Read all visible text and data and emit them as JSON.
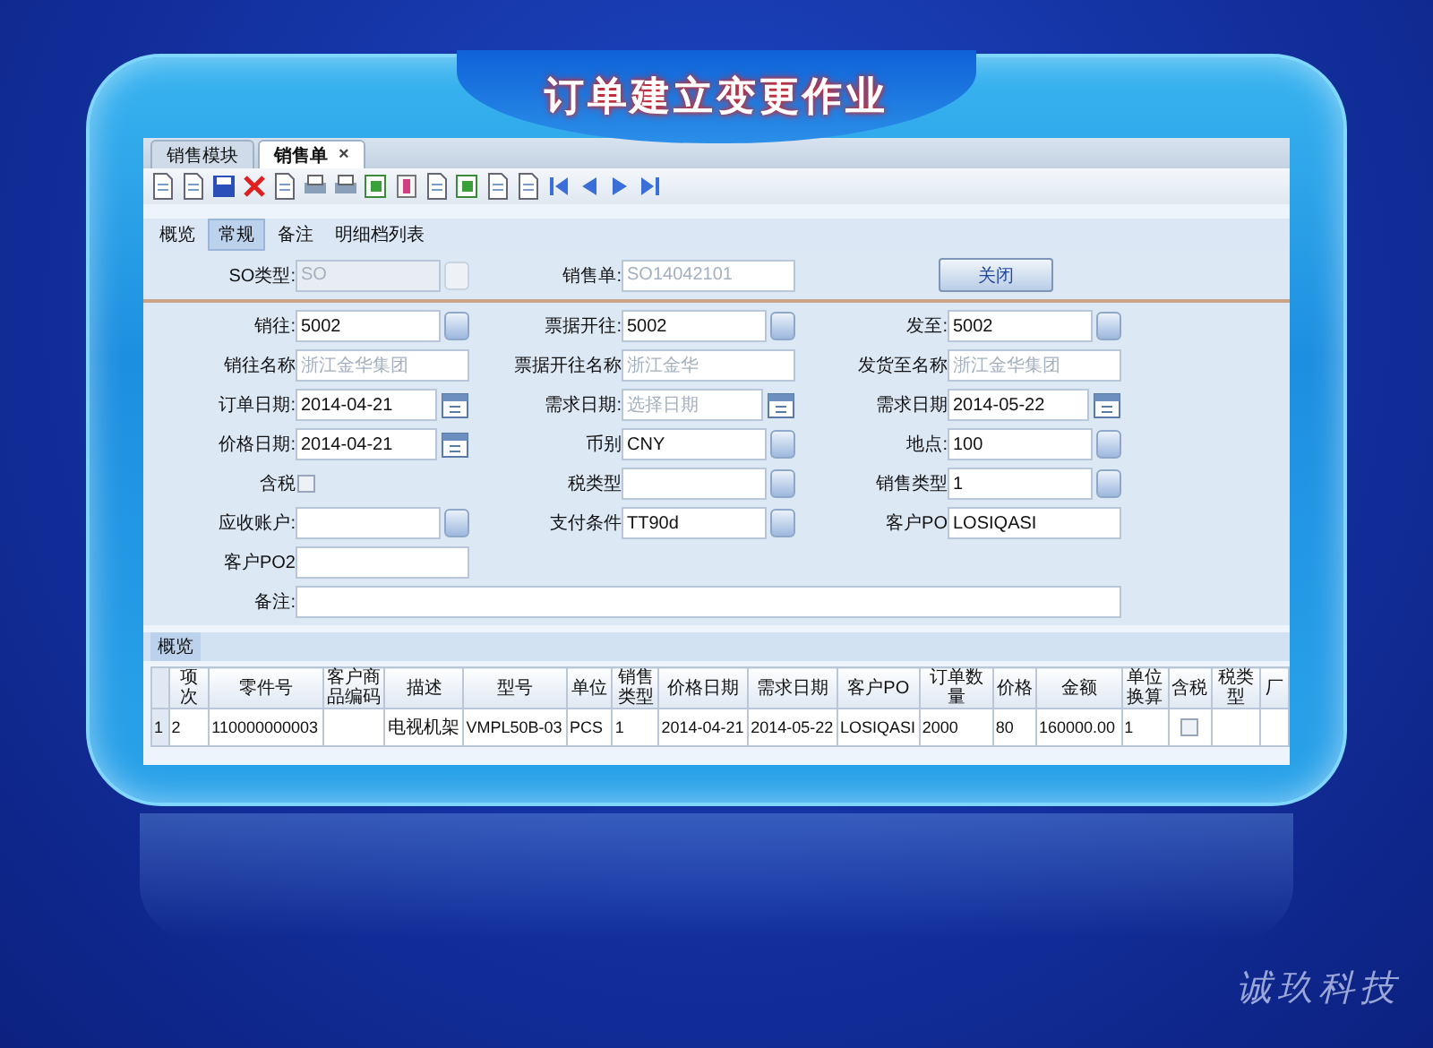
{
  "banner": {
    "title": "订单建立变更作业"
  },
  "tabs": [
    {
      "label": "销售模块",
      "selected": false
    },
    {
      "label": "销售单",
      "selected": true,
      "close": "×"
    }
  ],
  "subtabs": [
    {
      "label": "概览",
      "selected": false
    },
    {
      "label": "常规",
      "selected": true
    },
    {
      "label": "备注",
      "selected": false
    },
    {
      "label": "明细档列表",
      "selected": false
    }
  ],
  "form": {
    "rows": [
      {
        "fields": [
          {
            "kind": "combo",
            "label": "SO类型:",
            "placeholder": "SO",
            "disabled": true
          },
          {
            "kind": "text",
            "label": "销售单:",
            "placeholder": "SO14042101"
          },
          {
            "kind": "button",
            "label": "关闭"
          }
        ]
      },
      {
        "fields": [
          {
            "kind": "combo",
            "label": "销往:",
            "value": "5002"
          },
          {
            "kind": "combo",
            "label": "票据开往:",
            "value": "5002"
          },
          {
            "kind": "combo",
            "label": "发至:",
            "value": "5002"
          }
        ]
      },
      {
        "fields": [
          {
            "kind": "text",
            "label": "销往名称",
            "placeholder": "浙江金华集团"
          },
          {
            "kind": "text",
            "label": "票据开往名称",
            "placeholder": "浙江金华"
          },
          {
            "kind": "text",
            "label": "发货至名称",
            "placeholder": "浙江金华集团"
          }
        ]
      },
      {
        "fields": [
          {
            "kind": "date",
            "label": "订单日期:",
            "value": "2014-04-21"
          },
          {
            "kind": "date",
            "label": "需求日期:",
            "placeholder": "选择日期"
          },
          {
            "kind": "date",
            "label": "需求日期",
            "value": "2014-05-22"
          }
        ]
      },
      {
        "fields": [
          {
            "kind": "date",
            "label": "价格日期:",
            "value": "2014-04-21"
          },
          {
            "kind": "combo",
            "label": "币别",
            "value": "CNY"
          },
          {
            "kind": "combo",
            "label": "地点:",
            "value": "100"
          }
        ]
      },
      {
        "fields": [
          {
            "kind": "check",
            "label": "含税",
            "checked": false
          },
          {
            "kind": "combo",
            "label": "税类型"
          },
          {
            "kind": "combo",
            "label": "销售类型",
            "value": "1"
          }
        ]
      },
      {
        "fields": [
          {
            "kind": "combo",
            "label": "应收账户:"
          },
          {
            "kind": "combo",
            "label": "支付条件",
            "value": "TT90d"
          },
          {
            "kind": "text",
            "label": "客户PO",
            "value": "LOSIQASI"
          }
        ]
      },
      {
        "fields": [
          {
            "kind": "text",
            "label": "客户PO2"
          }
        ]
      },
      {
        "fields": [
          {
            "kind": "memo",
            "label": "备注:"
          }
        ]
      }
    ]
  },
  "grid": {
    "tab": "概览",
    "columns": [
      "项次",
      "零件号",
      "客户商品编码",
      "描述",
      "型号",
      "单位",
      "销售类型",
      "价格日期",
      "需求日期",
      "客户PO",
      "订单数量",
      "价格",
      "金额",
      "单位换算",
      "含税",
      "税类型",
      "厂"
    ],
    "rows": [
      {
        "row_header": "1",
        "cells": [
          {
            "kind": "text",
            "text": "2"
          },
          {
            "kind": "text",
            "text": "110000000003"
          },
          {
            "kind": "empty"
          },
          {
            "kind": "text",
            "text": "电视机架"
          },
          {
            "kind": "text",
            "text": "VMPL50B-03"
          },
          {
            "kind": "text",
            "text": "PCS"
          },
          {
            "kind": "text",
            "text": "1"
          },
          {
            "kind": "text",
            "text": "2014-04-21"
          },
          {
            "kind": "text",
            "text": "2014-05-22"
          },
          {
            "kind": "text",
            "text": "LOSIQASI"
          },
          {
            "kind": "text",
            "text": "2000"
          },
          {
            "kind": "text",
            "text": "80"
          },
          {
            "kind": "text",
            "text": "160000.00"
          },
          {
            "kind": "text",
            "text": "1"
          },
          {
            "kind": "check",
            "checked": false
          },
          {
            "kind": "empty"
          },
          {
            "kind": "empty"
          }
        ]
      }
    ]
  },
  "brand_text": "诚玖科技"
}
